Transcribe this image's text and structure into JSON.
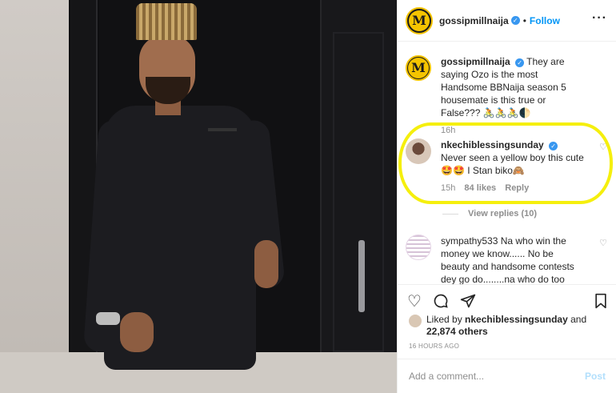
{
  "header": {
    "username": "gossipmillnaija",
    "verified_icon": "verified-badge-icon",
    "separator": "•",
    "follow_label": "Follow",
    "more_icon": "more-icon",
    "logo_letter": "M"
  },
  "caption": {
    "username": "gossipmillnaija",
    "text": "They are saying Ozo is the most Handsome BBNaija season 5 housemate is this true or False??? 🚴🚴🚴🌓",
    "time": "16h"
  },
  "comments": [
    {
      "username": "nkechiblessingsunday",
      "text": "Never seen a yellow boy this cute🤩🤩 I Stan biko🙈",
      "time": "15h",
      "likes": "84 likes",
      "reply_label": "Reply",
      "view_replies": "View replies (10)"
    },
    {
      "username": "sympathy533",
      "text": "Na who win the money we know...... No be beauty and handsome contests dey go do........na who do too much go"
    }
  ],
  "actions": {
    "like_icon": "heart-icon",
    "comment_icon": "comment-icon",
    "share_icon": "share-icon",
    "save_icon": "bookmark-icon"
  },
  "likes": {
    "prefix": "Liked by",
    "user": "nkechiblessingsunday",
    "joiner": "and",
    "others": "22,874 others"
  },
  "timestamp": "16 HOURS AGO",
  "add_comment": {
    "placeholder": "Add a comment...",
    "post_label": "Post"
  },
  "colors": {
    "accent": "#0095f6",
    "highlight": "#f5ef0d",
    "post_disabled": "#b2dffc"
  }
}
